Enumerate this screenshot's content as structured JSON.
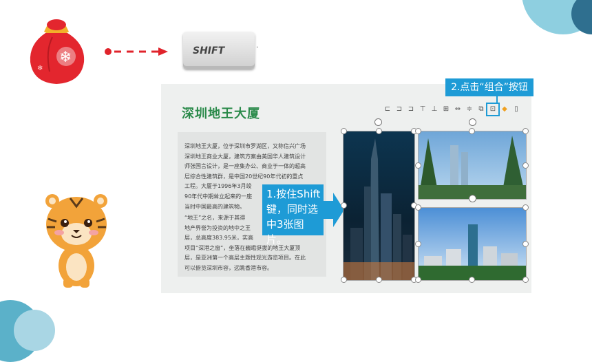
{
  "shift_key": {
    "label": "SHIFT",
    "trailing_mark": "·"
  },
  "slide": {
    "title": "深圳地王大厦",
    "paragraphs": [
      [
        "深圳地王大厦，位于深圳市罗湖区，又称信兴广场",
        "深圳地王商业大厦，建筑方案由美国华人建筑设计",
        "师张国言设计，是一座集办公、商业于一体的超高",
        "层综合性建筑群，是中国20世纪90年代初的重点",
        "工程。大厦于1996年3月竣",
        "90年代中期耸立起来的一座",
        "当时中国最高的建筑物。"
      ],
      [
        "“地王”之名，来源于其得",
        "地产界誉为投资的地中之王",
        "层，总高度383.95米，实高",
        "项目“深港之窗”，坐落在巍峨挺拔的地王大厦顶",
        "层，是亚洲第一个高层主题性观光游览项目。在此",
        "可以俯览深圳市容，远眺香港市容。"
      ]
    ]
  },
  "callout_step1": "1.按住Shift键，同时选中3张图片。",
  "callout_step2": "2.点击“组合”按钮",
  "toolbar_icons": [
    "align-left-icon",
    "align-center-icon",
    "align-right-icon",
    "align-top-icon",
    "align-middle-icon",
    "align-bottom-icon",
    "distribute-horizontal-icon",
    "distribute-vertical-icon",
    "bring-forward-icon",
    "group-icon",
    "fill-color-icon",
    "more-icon"
  ],
  "colors": {
    "accent": "#1e9bd6",
    "title_green": "#2a8a4a",
    "dash_red": "#e0232b"
  }
}
